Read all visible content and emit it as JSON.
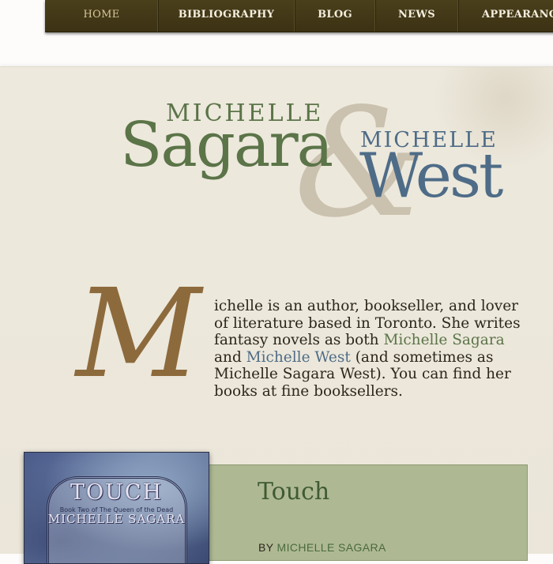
{
  "nav": {
    "items": [
      {
        "label": "HOME",
        "active": true
      },
      {
        "label": "BIBLIOGRAPHY",
        "active": false
      },
      {
        "label": "BLOG",
        "active": false
      },
      {
        "label": "NEWS",
        "active": false
      },
      {
        "label": "APPEARANCES",
        "active": false
      }
    ]
  },
  "logo": {
    "sagara_first": "MICHELLE",
    "sagara_last": "Sagara",
    "ampersand": "&",
    "west_first": "MICHELLE",
    "west_last": "West"
  },
  "intro": {
    "dropcap": "M",
    "text_before": "ichelle is an author, bookseller, and lover of literature based in Toronto. She writes fantasy novels as both ",
    "link_sagara": "Michelle Sagara",
    "text_and": " and ",
    "link_west": "Michelle West",
    "text_after": " (and sometimes as Michelle Sagara West). You can find her books at fine booksellers."
  },
  "featured_book": {
    "cover_title": "TOUCH",
    "cover_subtitle": "Book Two of The Queen of the Dead",
    "cover_author": "MICHELLE SAGARA",
    "title": "Touch",
    "by_prefix": "BY ",
    "author": "MICHELLE SAGARA"
  },
  "colors": {
    "nav_bg": "#4a3f1b",
    "sagara_green": "#5b7448",
    "west_blue": "#4e6c87",
    "ampersand": "#cbc1af",
    "dropcap": "#8d6a3c",
    "book_panel": "#aeb994"
  }
}
